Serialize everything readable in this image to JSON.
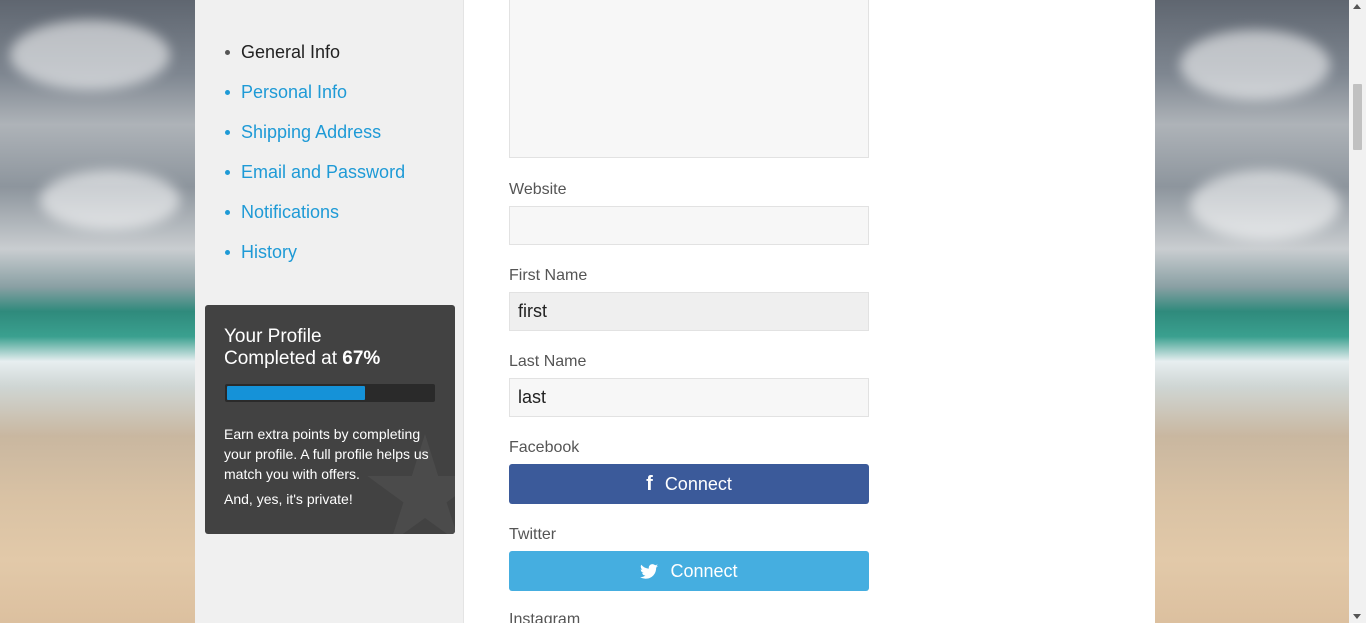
{
  "sidebar": {
    "items": [
      {
        "label": "General Info",
        "active": true
      },
      {
        "label": "Personal Info",
        "active": false
      },
      {
        "label": "Shipping Address",
        "active": false
      },
      {
        "label": "Email and Password",
        "active": false
      },
      {
        "label": "Notifications",
        "active": false
      },
      {
        "label": "History",
        "active": false
      }
    ]
  },
  "profile": {
    "title_line1": "Your Profile",
    "title_line2": "Completed at",
    "percent": "67%",
    "progress": 0.67,
    "text1": "Earn extra points by completing your profile. A full profile helps us match you with offers.",
    "text2": "And, yes, it's private!"
  },
  "form": {
    "website": {
      "label": "Website",
      "value": ""
    },
    "first_name": {
      "label": "First Name",
      "value": "first"
    },
    "last_name": {
      "label": "Last Name",
      "value": "last"
    },
    "facebook": {
      "label": "Facebook",
      "button": "Connect",
      "icon": "facebook-icon",
      "color": "#3b5a9a"
    },
    "twitter": {
      "label": "Twitter",
      "button": "Connect",
      "icon": "twitter-icon",
      "color": "#45aee0"
    },
    "instagram": {
      "label": "Instagram"
    }
  },
  "colors": {
    "link": "#1e9ad6",
    "progress": "#1592d8"
  }
}
